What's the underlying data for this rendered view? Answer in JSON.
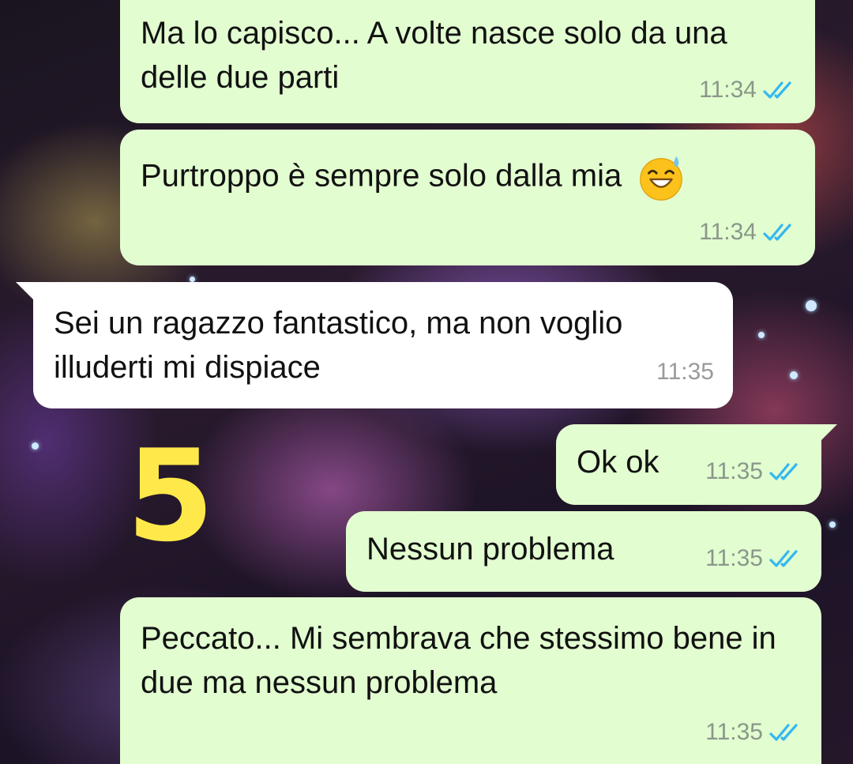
{
  "messages": [
    {
      "direction": "outgoing",
      "text": "Ma lo capisco... A volte nasce solo da una delle due parti",
      "time": "11:34",
      "status": "read"
    },
    {
      "direction": "outgoing",
      "text": "Purtroppo è sempre solo dalla mia",
      "emoji": "grinning-face-with-sweat",
      "time": "11:34",
      "status": "read"
    },
    {
      "direction": "incoming",
      "text": "Sei un ragazzo fantastico, ma non voglio illuderti mi dispiace",
      "time": "11:35"
    },
    {
      "direction": "outgoing",
      "text": "Ok ok",
      "time": "11:35",
      "status": "read"
    },
    {
      "direction": "outgoing",
      "text": "Nessun problema",
      "time": "11:35",
      "status": "read"
    },
    {
      "direction": "outgoing",
      "text": "Peccato... Mi sembrava che stessimo bene in due ma nessun problema",
      "time": "11:35",
      "status": "read"
    }
  ],
  "annotation": {
    "text": "5",
    "color": "#ffe94a"
  },
  "colors": {
    "outgoing_bubble": "#e2fdd0",
    "incoming_bubble": "#ffffff",
    "read_ticks": "#34b7f1"
  }
}
